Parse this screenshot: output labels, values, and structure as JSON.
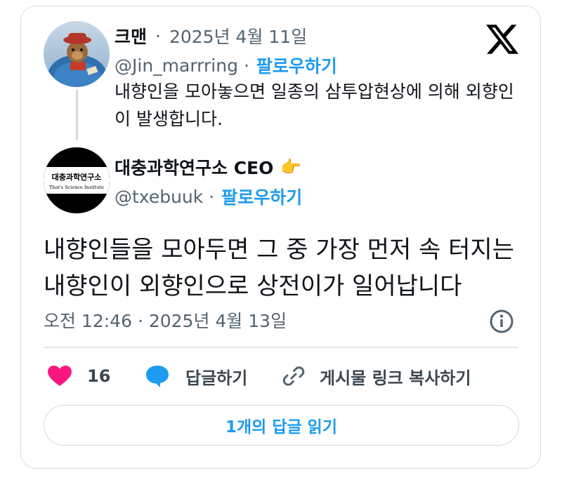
{
  "parent_post": {
    "display_name": "크맨",
    "separator": "·",
    "date": "2025년 4월 11일",
    "handle": "@Jin_marrring",
    "follow_label": "팔로우하기",
    "text": "내향인을 모아놓으면 일종의 삼투압현상에 의해 외향인이 발생합니다."
  },
  "main_post": {
    "display_name": "대충과학연구소 CEO",
    "emoji": "👉",
    "handle": "@txebuuk",
    "separator": "·",
    "follow_label": "팔로우하기",
    "avatar_text_ko": "대충과학연구소",
    "avatar_text_en": "That's Science Institute",
    "text": "내향인들을 모아두면 그 중 가장 먼저 속 터지는 내향인이 외향인으로 상전이가 일어납니다",
    "timestamp": "오전 12:46 · 2025년 4월 13일"
  },
  "actions": {
    "like_count": "16",
    "reply_label": "답글하기",
    "copy_link_label": "게시물 링크 복사하기"
  },
  "read_replies_label": "1개의 답글 읽기",
  "colors": {
    "accent": "#1d9bf0",
    "like": "#f91880",
    "text": "#0f1419",
    "muted": "#536471"
  },
  "icons": [
    "x-logo-icon",
    "info-icon",
    "heart-icon",
    "reply-bubble-icon",
    "link-icon"
  ]
}
